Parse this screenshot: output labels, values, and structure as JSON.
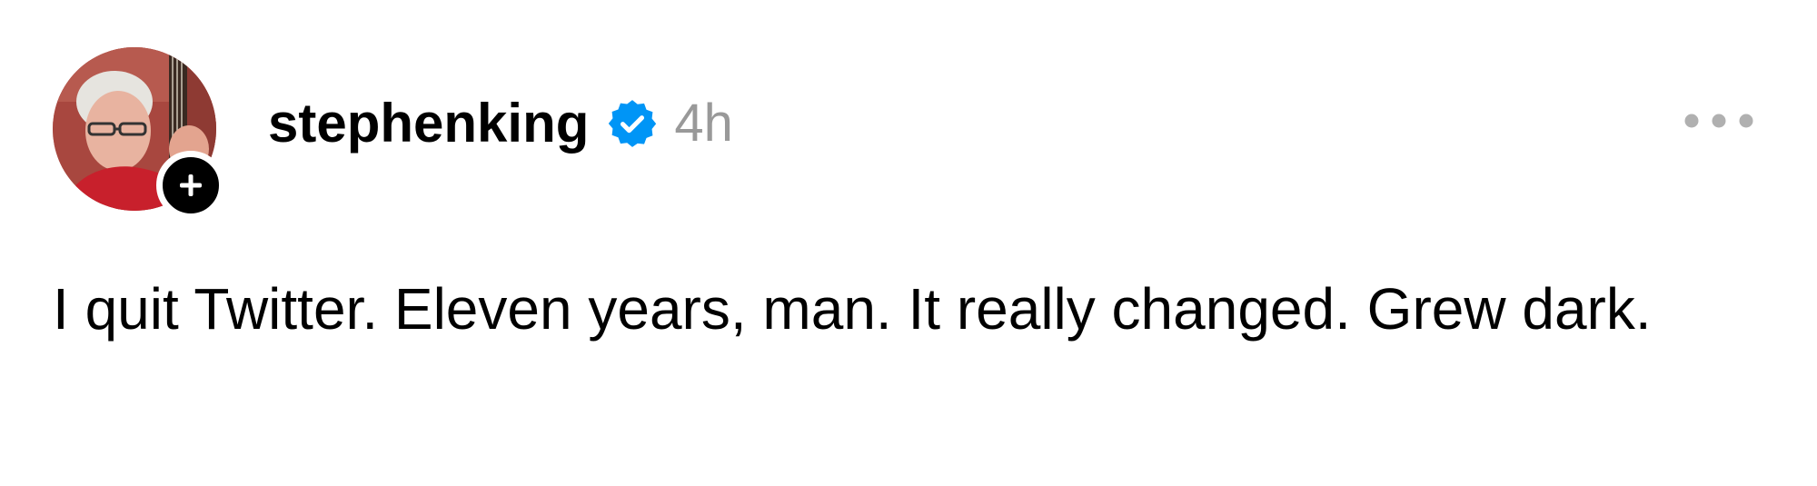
{
  "post": {
    "author": {
      "username": "stephenking",
      "verified": true,
      "avatar_icon": "author-avatar",
      "follow_icon": "plus-icon"
    },
    "timestamp": "4h",
    "more_icon": "ellipsis-icon",
    "text": "I quit Twitter. Eleven years, man. It really changed. Grew dark."
  },
  "colors": {
    "background": "#ffffff",
    "text": "#000000",
    "timestamp": "#999999",
    "verified_badge": "#0095f6",
    "more_icon": "#b0b0b0"
  }
}
